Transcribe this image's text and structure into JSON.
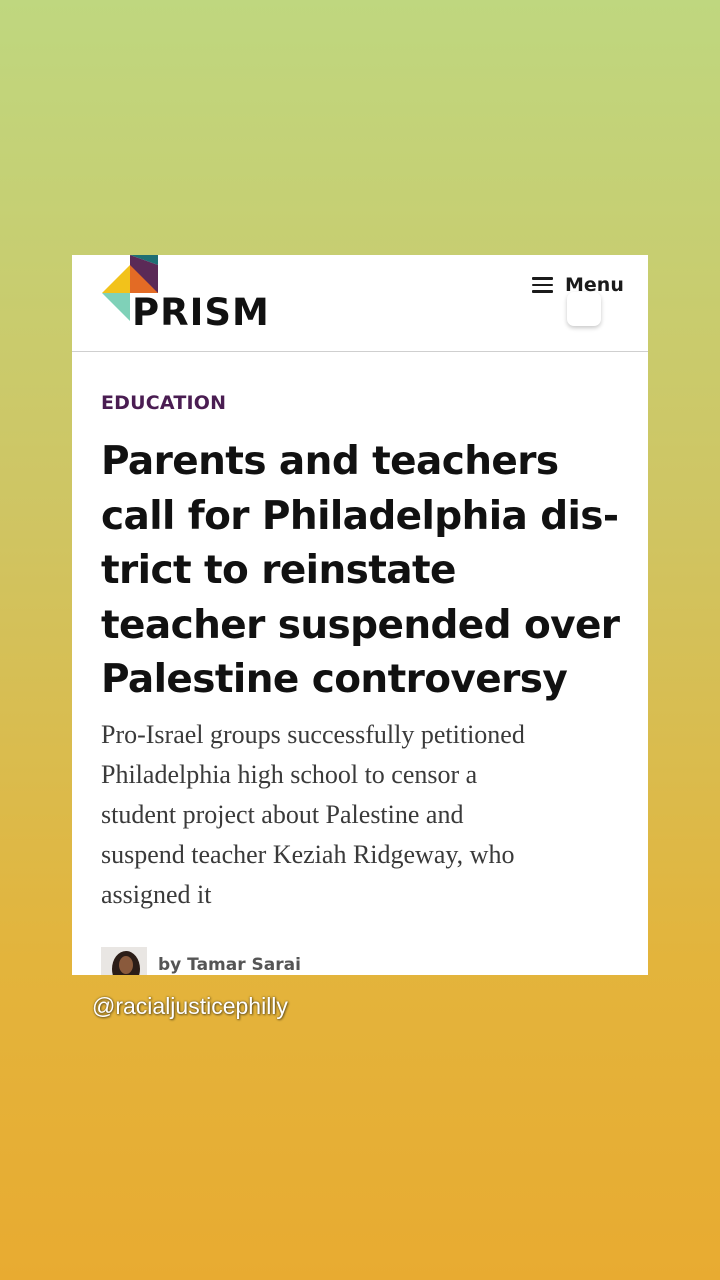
{
  "logo": {
    "wordmark": "PRISM"
  },
  "header": {
    "menu_label": "Menu"
  },
  "article": {
    "category": "EDUCATION",
    "headline_lines": [
      "Parents and teachers",
      "call for Philadelphia dis-",
      "trict to reinstate",
      "teacher suspended over",
      "Palestine controversy"
    ],
    "dek_lines": [
      "Pro-Israel groups successfully petitioned",
      "Philadelphia high school to censor a",
      "student project about Palestine and",
      "suspend teacher Keziah Ridgeway, who",
      "assigned it"
    ],
    "byline": "by Tamar Sarai"
  },
  "overlay": {
    "handle": "@racialjusticephilly"
  },
  "colors": {
    "category": "#4a1d52",
    "logo_purple": "#5b2a57",
    "logo_teal": "#1f6f73",
    "logo_orange": "#e36b25",
    "logo_yellow": "#f2c21b",
    "logo_mint": "#7fd1b8"
  }
}
